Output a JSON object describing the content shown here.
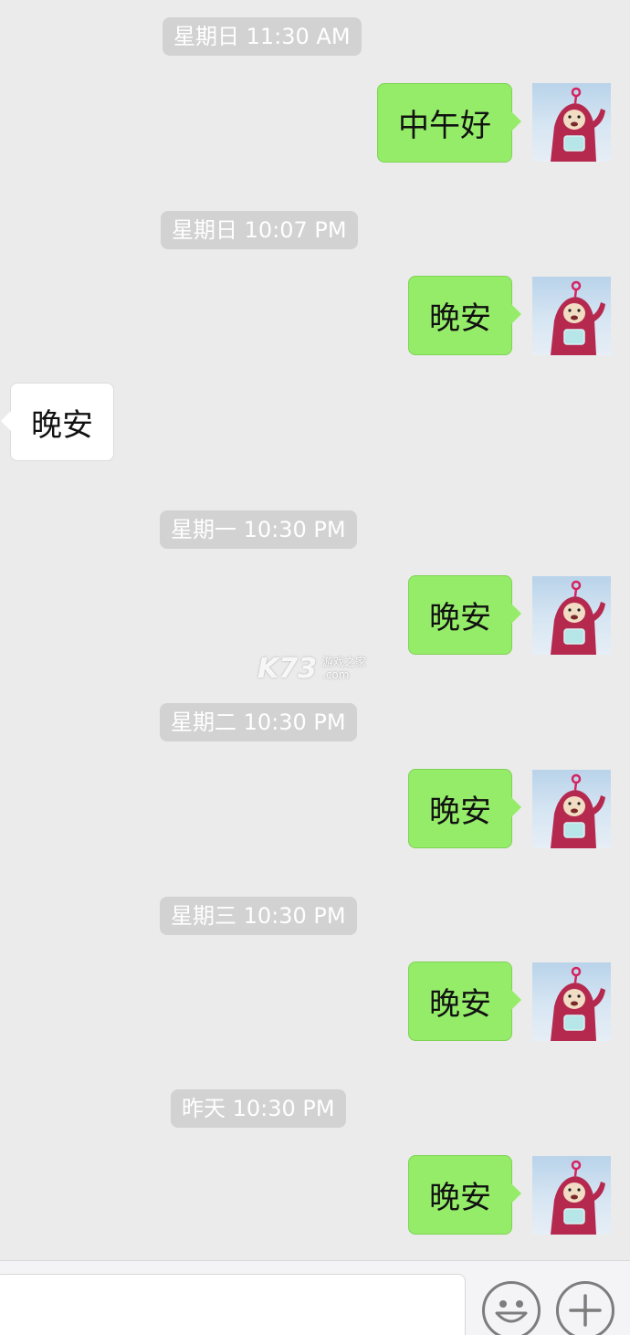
{
  "timestamps": {
    "t1": "星期日 11:30 AM",
    "t2": "星期日 10:07 PM",
    "t3": "星期一 10:30 PM",
    "t4": "星期二 10:30 PM",
    "t5": "星期三 10:30 PM",
    "t6": "昨天 10:30 PM"
  },
  "messages": {
    "m1": "中午好",
    "m2": "晚安",
    "m3": "晚安",
    "m4": "晚安",
    "m5": "晚安",
    "m6": "晚安",
    "m7": "晚安"
  },
  "watermark": {
    "logo": "K73",
    "line1": "游戏之家",
    "line2": ".com"
  },
  "icons": {
    "avatar": "teletubby-po-avatar-icon",
    "emoji": "emoji-smiley-icon",
    "plus": "plus-icon"
  },
  "colors": {
    "background": "#ebebeb",
    "outgoing_bubble": "#95ec69",
    "incoming_bubble": "#ffffff",
    "timestamp_bg": "#d2d2d2"
  }
}
